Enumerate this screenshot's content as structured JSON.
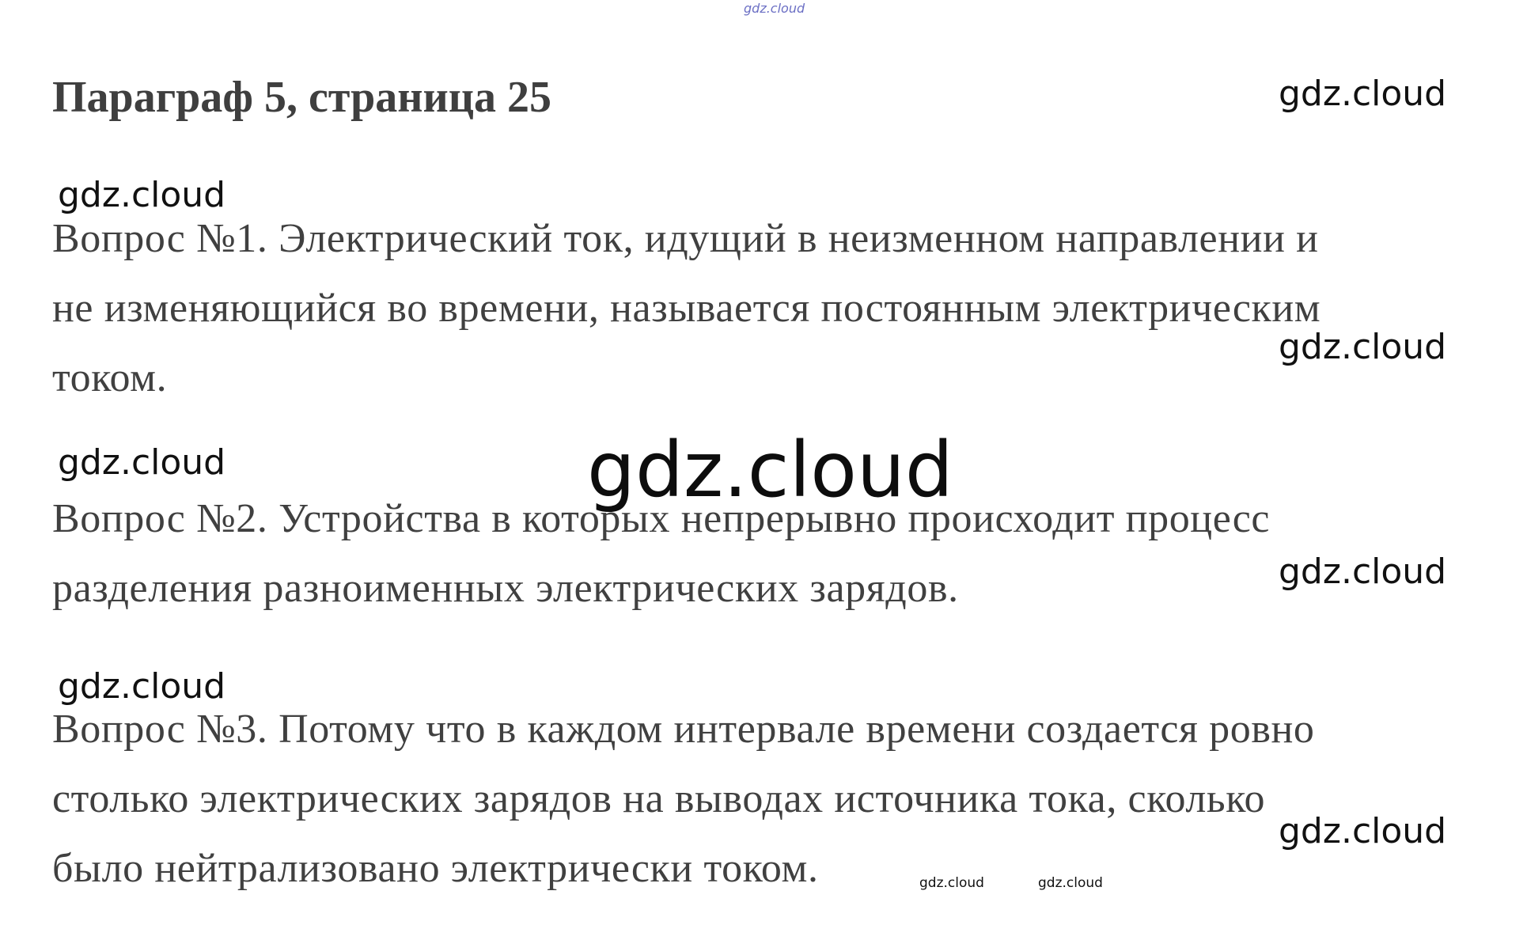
{
  "header": {
    "title": "Параграф 5, страница 25"
  },
  "answers": [
    {
      "lines": [
        "Вопрос №1. Электрический ток, идущий в неизменном направлении и",
        "не изменяющийся во времени, называется постоянным электрическим",
        "током."
      ]
    },
    {
      "lines": [
        "Вопрос №2. Устройства в которых непрерывно происходит процесс",
        "разделения разноименных электрических зарядов."
      ]
    },
    {
      "lines": [
        "Вопрос №3. Потому что в каждом интервале времени создается ровно",
        "столько электрических зарядов на выводах источника тока, сколько",
        "было нейтрализовано электрически током."
      ]
    }
  ],
  "watermark": {
    "text": "gdz.cloud"
  }
}
